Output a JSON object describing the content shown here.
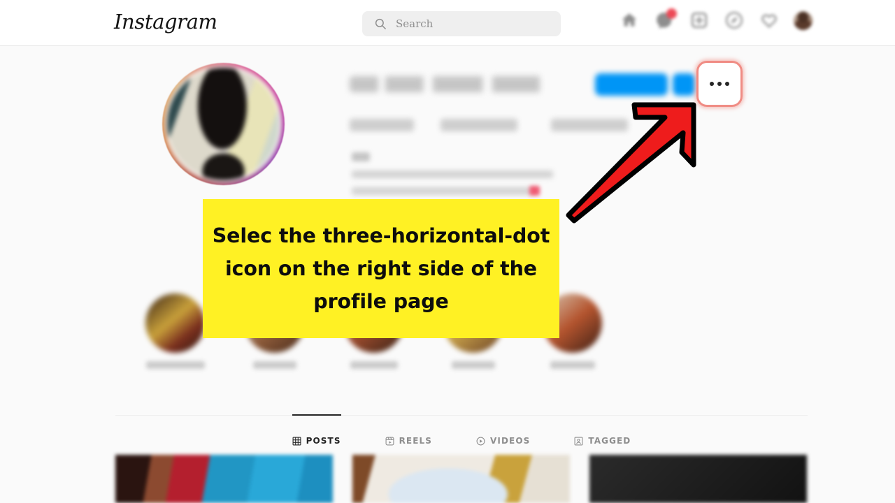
{
  "app": {
    "brand": "Instagram",
    "page_background": "#fafafa",
    "header_background": "#ffffff"
  },
  "header": {
    "search": {
      "placeholder": "Search",
      "value": "",
      "icon": "search-icon",
      "background": "#efefef"
    },
    "nav_icons": [
      {
        "name": "home-icon",
        "label": "Home",
        "badge": null
      },
      {
        "name": "messenger-icon",
        "label": "Messages",
        "badge": {
          "color": "#ed4956",
          "count": ""
        }
      },
      {
        "name": "new-post-icon",
        "label": "New post",
        "badge": null
      },
      {
        "name": "explore-icon",
        "label": "Explore",
        "badge": null
      },
      {
        "name": "heart-icon",
        "label": "Notifications",
        "badge": null
      },
      {
        "name": "profile-avatar",
        "label": "Profile",
        "badge": null
      }
    ]
  },
  "profile": {
    "avatar": {
      "has_story_ring": true,
      "ring_colors": [
        "#d9568f",
        "#8e3aa8",
        "#d98a4e"
      ],
      "blurred": true
    },
    "username": "",
    "username_blurred": true,
    "actions": {
      "primary_button_label": "",
      "primary_button_color": "#0095f6",
      "secondary_button_label": "",
      "more_button": {
        "name": "more-options-button",
        "icon": "three-horizontal-dots-icon",
        "dots": 3,
        "highlighted": true,
        "highlight_color": "#f08c84"
      }
    },
    "stats": [
      {
        "label": "posts",
        "value": "",
        "blurred": true
      },
      {
        "label": "followers",
        "value": "",
        "blurred": true
      },
      {
        "label": "following",
        "value": "",
        "blurred": true
      }
    ],
    "bio": {
      "display_name": "",
      "lines": [
        "",
        ""
      ],
      "blurred": true
    }
  },
  "highlights": [
    {
      "label": "",
      "blurred": true
    },
    {
      "label": "",
      "blurred": true
    },
    {
      "label": "",
      "blurred": true
    },
    {
      "label": "",
      "blurred": true
    },
    {
      "label": "",
      "blurred": true
    }
  ],
  "tabs": [
    {
      "label": "POSTS",
      "icon": "grid-icon",
      "active": true
    },
    {
      "label": "REELS",
      "icon": "reels-icon",
      "active": false
    },
    {
      "label": "VIDEOS",
      "icon": "play-circle-icon",
      "active": false
    },
    {
      "label": "TAGGED",
      "icon": "tagged-icon",
      "active": false
    }
  ],
  "posts_grid": [
    {
      "name": "post-thumbnail-1",
      "blurred": true
    },
    {
      "name": "post-thumbnail-2",
      "blurred": true
    },
    {
      "name": "post-thumbnail-3",
      "blurred": true
    }
  ],
  "annotation": {
    "callout_text": "Selec the three-horizontal-dot icon on the right side of the profile page",
    "callout_background": "#fff124",
    "callout_text_color": "#0d0d0d",
    "arrow": {
      "name": "pointer-arrow",
      "color": "#ee1c1c",
      "outline_color": "#000000",
      "direction": "up-right",
      "points_to": "more-options-button"
    }
  }
}
